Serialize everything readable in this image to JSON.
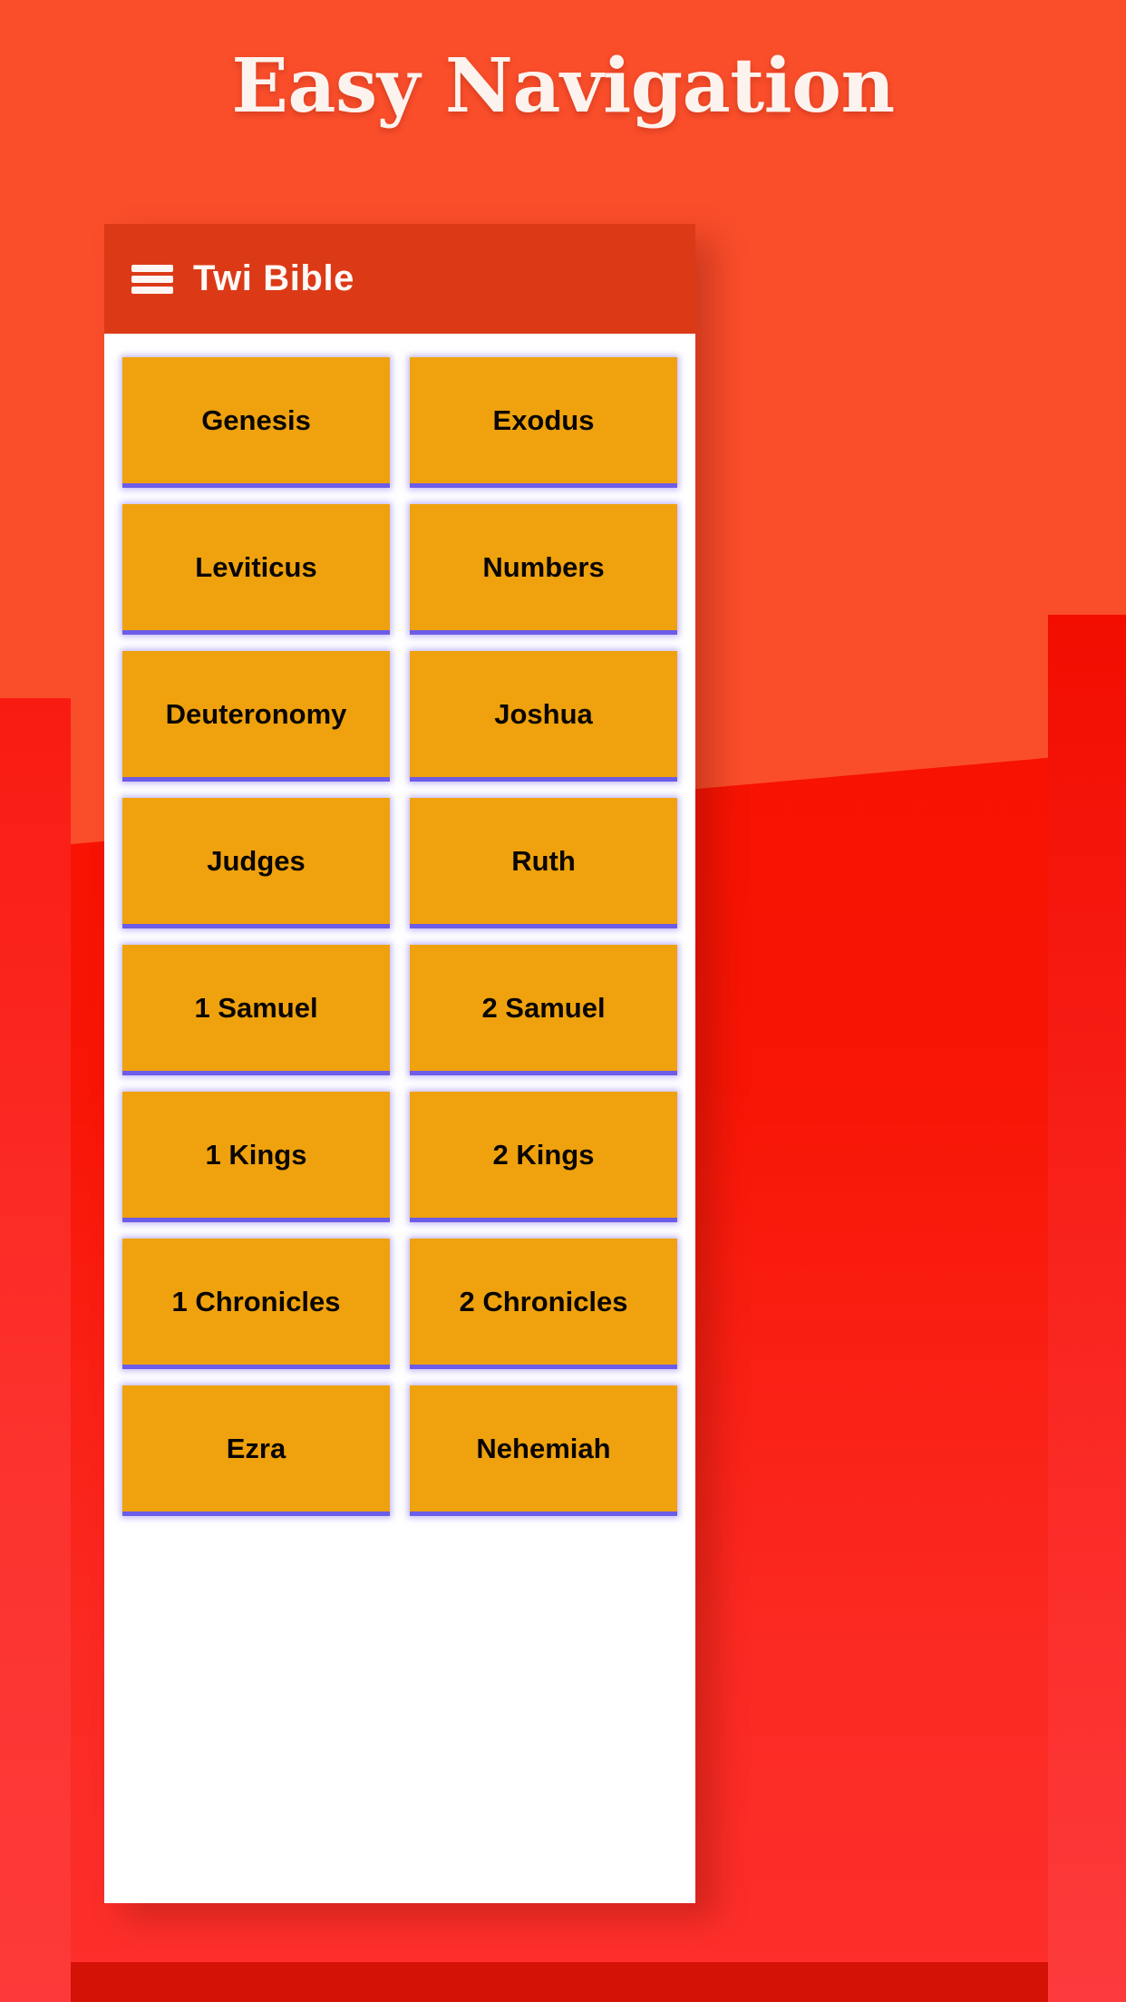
{
  "headline": "Easy Navigation",
  "app": {
    "menu_icon": "hamburger-menu-icon",
    "title": "Twi Bible"
  },
  "colors": {
    "background_top": "#fa4e2b",
    "background_bottom": "#f71100",
    "appbar": "#dc3a17",
    "button_fill": "#efa20d",
    "button_accent": "#6c5ce7",
    "button_text": "#0a0603",
    "headline_text": "#fdf3ee",
    "content_background": "#ffffff"
  },
  "books": [
    "Genesis",
    "Exodus",
    "Leviticus",
    "Numbers",
    "Deuteronomy",
    "Joshua",
    "Judges",
    "Ruth",
    "1 Samuel",
    "2 Samuel",
    "1 Kings",
    "2 Kings",
    "1 Chronicles",
    "2 Chronicles",
    "Ezra",
    "Nehemiah"
  ]
}
